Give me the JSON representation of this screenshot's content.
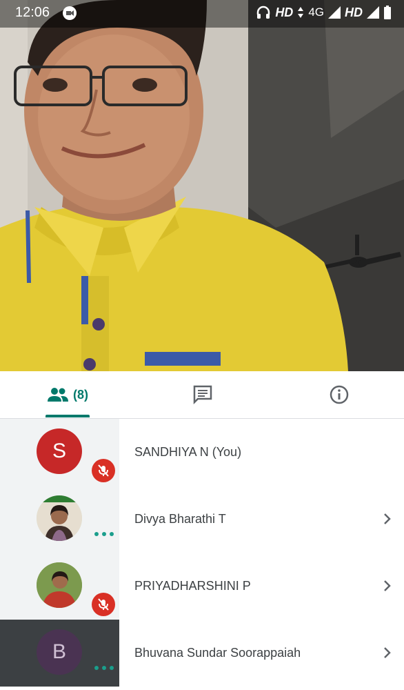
{
  "status_bar": {
    "time": "12:06",
    "hd1": "HD",
    "network": "4G",
    "hd2": "HD"
  },
  "tabs": {
    "people_count": "(8)"
  },
  "participants": [
    {
      "name": "SANDHIYA N (You)",
      "avatar_letter": "S",
      "avatar_color": "#c62828",
      "muted": true,
      "has_chevron": false
    },
    {
      "name": "Divya Bharathi T",
      "avatar_letter": "",
      "muted": false,
      "has_chevron": true
    },
    {
      "name": "PRIYADHARSHINI P",
      "avatar_letter": "",
      "muted": true,
      "has_chevron": true
    },
    {
      "name": "Bhuvana Sundar Soorappaiah",
      "avatar_letter": "B",
      "avatar_color": "#4a3352",
      "muted": false,
      "has_chevron": true
    }
  ],
  "colors": {
    "accent": "#00796b",
    "mute": "#d93025",
    "shirt": "#e8cf3c"
  }
}
